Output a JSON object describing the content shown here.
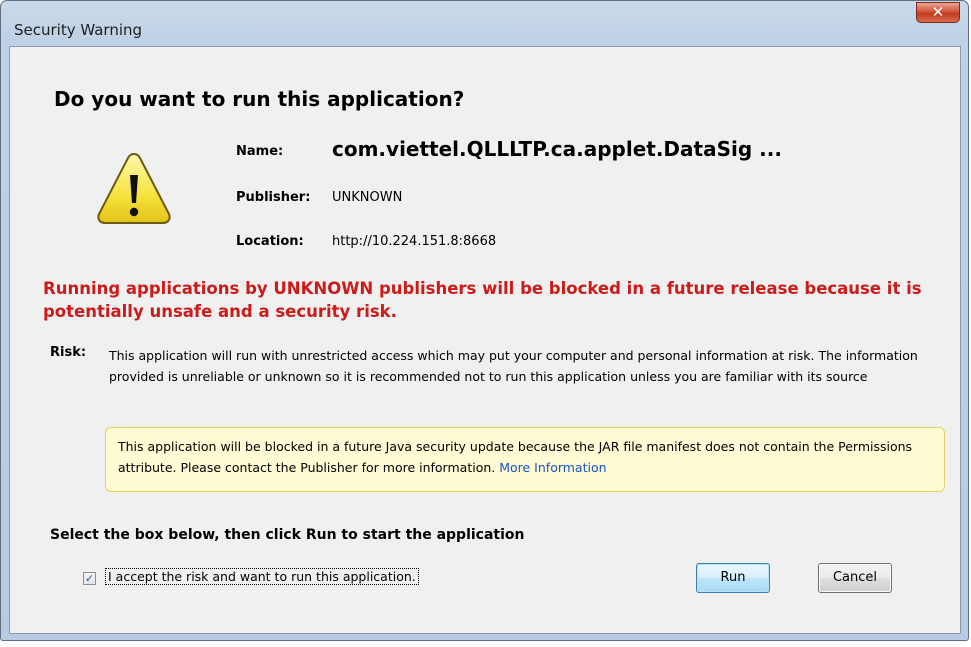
{
  "window": {
    "title": "Security Warning",
    "close_glyph": "✕"
  },
  "heading": "Do you want to run this application?",
  "icon": {
    "name": "warning-icon",
    "color": "#f5e14a"
  },
  "info": {
    "name_label": "Name:",
    "name_value": "com.viettel.QLLLTP.ca.applet.DataSig ...",
    "publisher_label": "Publisher:",
    "publisher_value": "UNKNOWN",
    "location_label": "Location:",
    "location_value": "http://10.224.151.8:8668"
  },
  "warning": {
    "text": "Running applications by UNKNOWN publishers will be blocked in a future release because it is potentially unsafe and a security risk.",
    "color": "#cc1b1b"
  },
  "risk": {
    "label": "Risk:",
    "text": "This application will run with unrestricted access which may put your computer and personal information at risk. The information provided is unreliable or unknown so it is recommended not to run this application unless you are familiar with its source"
  },
  "notice": {
    "text": "This application will be blocked in a future Java security update because the JAR file manifest does not contain the Permissions attribute. Please contact the Publisher for more information.",
    "link": "More Information"
  },
  "select_heading": "Select the box below, then click Run to start the application",
  "accept": {
    "checked": true,
    "check_glyph": "✓",
    "label": "I accept the risk and want to run this application."
  },
  "buttons": {
    "run": "Run",
    "cancel": "Cancel"
  }
}
